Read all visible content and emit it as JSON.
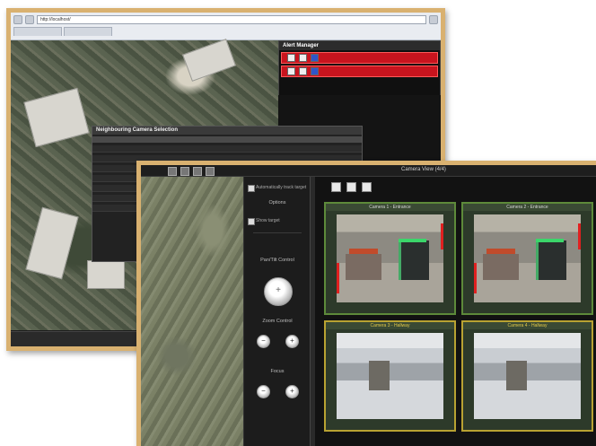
{
  "back": {
    "alarm_panel_title": "Alert Manager",
    "dialog_title": "Neighbouring Camera Selection",
    "address_text": "http://localhost/"
  },
  "front": {
    "window_title": "Camera View (4/4)",
    "options_label": "Options",
    "ptz_label": "Pan/Tilt Control",
    "zoom_label": "Zoom Control",
    "focus_label": "Focus",
    "check1_label": "Automatically track target",
    "check2_label": "Show target",
    "cells": [
      {
        "title": "Camera 1 - Entrance",
        "style": "store",
        "border": "green"
      },
      {
        "title": "Camera 2 - Entrance",
        "style": "store",
        "border": "green"
      },
      {
        "title": "Camera 3 - Hallway",
        "style": "hall",
        "border": "yellow"
      },
      {
        "title": "Camera 4 - Hallway",
        "style": "hall",
        "border": "yellow"
      }
    ]
  },
  "colors": {
    "frame_border": "#d9b170",
    "alarm_red": "#c8141e",
    "cell_green": "#5d8a3a",
    "cell_yellow": "#b8a232"
  }
}
